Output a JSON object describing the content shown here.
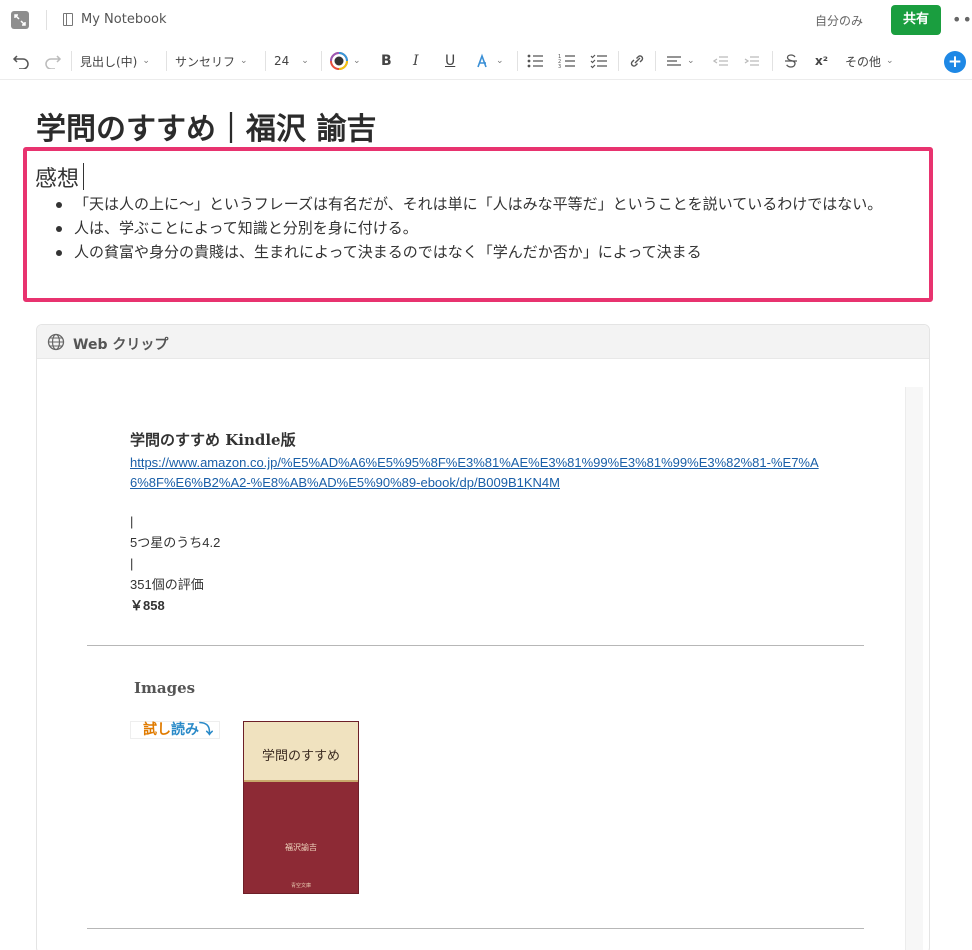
{
  "header": {
    "notebook_name": "My Notebook",
    "visibility": "自分のみ",
    "share_label": "共有"
  },
  "toolbar": {
    "heading_style": "見出し(中)",
    "font_family": "サンセリフ",
    "font_size": "24",
    "bold": "B",
    "italic": "I",
    "underline": "U",
    "superscript": "x²",
    "more": "その他"
  },
  "note": {
    "title": "学問のすすめ｜福沢 諭吉",
    "section_heading": "感想",
    "bullets": [
      "「天は人の上に〜」というフレーズは有名だが、それは単に「人はみな平等だ」ということを説いているわけではない。",
      "人は、学ぶことによって知識と分別を身に付ける。",
      "人の貧富や身分の貴賤は、生まれによって決まるのではなく「学んだか否か」によって決まる"
    ]
  },
  "webclip": {
    "header": "Web クリップ",
    "book_title": "学問のすすめ Kindle版",
    "link": "https://www.amazon.co.jp/%E5%AD%A6%E5%95%8F%E3%81%AE%E3%81%99%E3%81%99%E3%82%81-%E7%A6%8F%E6%B2%A2-%E8%AB%AD%E5%90%89-ebook/dp/B009B1KN4M",
    "sep1": "|",
    "rating": "5つ星のうち4.2",
    "sep2": "|",
    "review_count": "351個の評価",
    "price": "￥858",
    "images_heading": "Images",
    "tachiyomi_a": "試し",
    "tachiyomi_b": "読み",
    "tachiyomi_arrow": "⤵",
    "cover_title": "学問のすすめ",
    "cover_author": "福沢諭吉",
    "cover_publisher": "青空文庫"
  }
}
